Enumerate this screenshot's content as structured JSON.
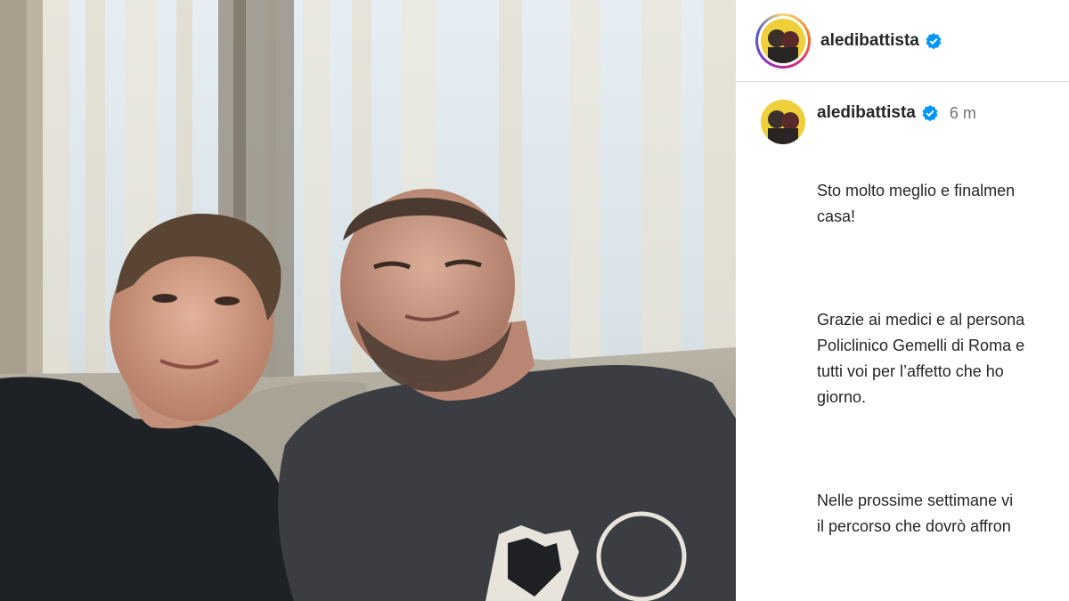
{
  "post": {
    "username": "aledibattista",
    "verified": true,
    "time": "6 m",
    "caption": [
      "Sto molto meglio e finalmen\ncasa!",
      "Grazie ai medici e al persona\nPoliclinico Gemelli di Roma e\ntutti voi per l’affetto che ho\ngiorno.",
      "Nelle prossime settimane vi\nil percorso che dovrò affron"
    ]
  },
  "icons": {
    "verified": "verified-badge-icon",
    "avatar": "profile-picture"
  },
  "colors": {
    "verified": "#0095f6",
    "text": "#262626",
    "muted": "#737373",
    "avatar_bg": "#f0d03a"
  }
}
